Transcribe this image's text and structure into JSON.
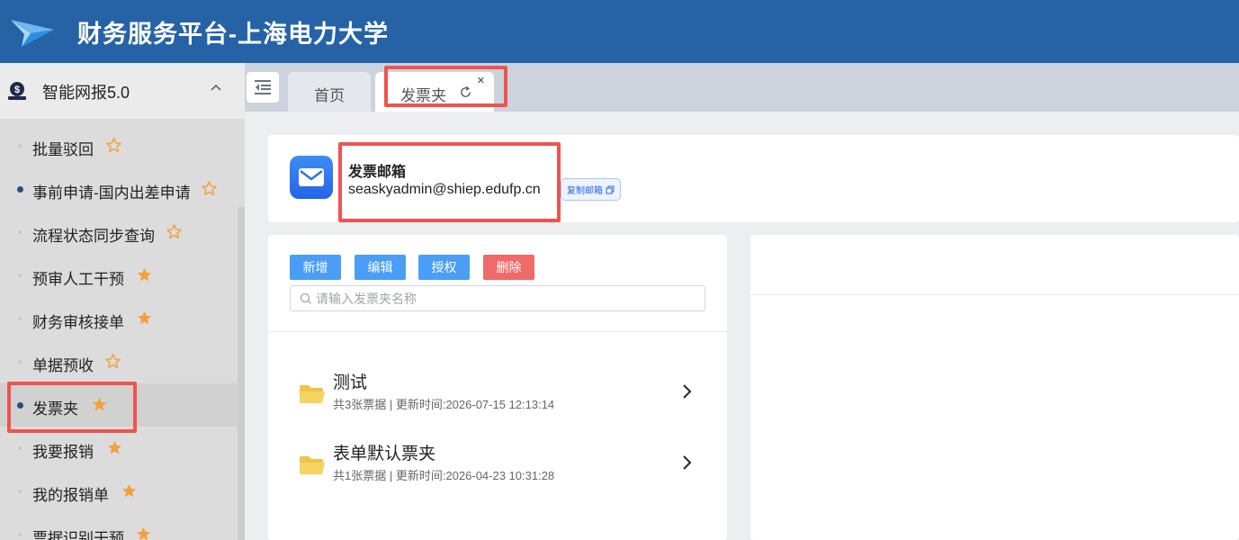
{
  "header": {
    "title": "财务服务平台-上海电力大学"
  },
  "sidebar": {
    "group_label": "智能网报5.0",
    "items": [
      {
        "label": "批量驳回",
        "star": "outline",
        "dot": "faint"
      },
      {
        "label": "事前申请-国内出差申请",
        "star": "outline",
        "dot": "solid"
      },
      {
        "label": "流程状态同步查询",
        "star": "outline",
        "dot": "faint"
      },
      {
        "label": "预审人工干预",
        "star": "filled",
        "dot": "faint"
      },
      {
        "label": "财务审核接单",
        "star": "filled",
        "dot": "faint"
      },
      {
        "label": "单据预收",
        "star": "outline",
        "dot": "faint"
      },
      {
        "label": "发票夹",
        "star": "filled",
        "dot": "solid",
        "active": true
      },
      {
        "label": "我要报销",
        "star": "filled",
        "dot": "faint"
      },
      {
        "label": "我的报销单",
        "star": "filled",
        "dot": "faint"
      },
      {
        "label": "票据识别干预",
        "star": "filled",
        "dot": "faint"
      }
    ]
  },
  "tabs": [
    {
      "label": "首页"
    },
    {
      "label": "发票夹",
      "close": "×"
    }
  ],
  "mailbox": {
    "title": "发票邮箱",
    "address": "seaskyadmin@shiep.edufp.cn",
    "copy_label": "复制邮箱"
  },
  "toolbar": {
    "add_label": "新增",
    "edit_label": "编辑",
    "auth_label": "授权",
    "delete_label": "删除"
  },
  "search": {
    "placeholder": "请输入发票夹名称"
  },
  "folders": [
    {
      "name": "测试",
      "meta": "共3张票据 | 更新时间:2026-07-15 12:13:14"
    },
    {
      "name": "表单默认票夹",
      "meta": "共1张票据 | 更新时间:2026-04-23 10:31:28"
    }
  ],
  "colors": {
    "header_bg": "#2563a6",
    "primary_button": "#4a9ef5",
    "danger_button": "#f06a6a",
    "star": "#f5a03a",
    "highlight": "#ef5350"
  }
}
